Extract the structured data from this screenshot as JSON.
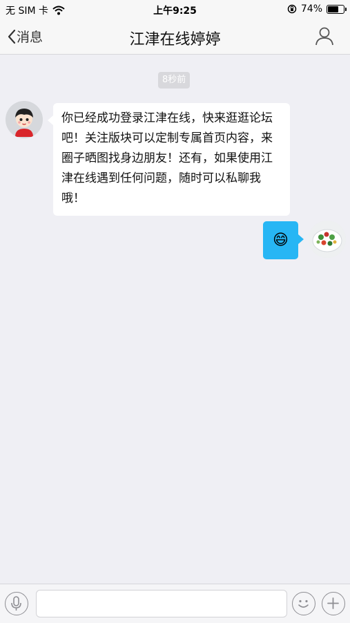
{
  "status_bar": {
    "carrier": "无 SIM 卡",
    "time": "上午9:25",
    "battery_percent": "74%",
    "battery_level": 0.74
  },
  "nav": {
    "back_label": "消息",
    "title": "江津在线婷婷"
  },
  "chat": {
    "timestamp": "8秒前",
    "messages": [
      {
        "side": "left",
        "text": "你已经成功登录江津在线，快来逛逛论坛吧！关注版块可以定制专属首页内容，来圈子晒图找身边朋友！还有，如果使用江津在线遇到任何问题，随时可以私聊我哦！"
      },
      {
        "side": "right",
        "emoji": "😄"
      }
    ]
  },
  "input_bar": {
    "value": "",
    "placeholder": ""
  },
  "colors": {
    "background": "#efeff4",
    "outgoing_bubble": "#27b6f4",
    "incoming_bubble": "#ffffff"
  },
  "icons": {
    "back": "chevron-left-icon",
    "profile": "person-icon",
    "voice": "microphone-icon",
    "emoji": "smiley-icon",
    "plus": "plus-icon",
    "wifi": "wifi-icon",
    "lock": "rotation-lock-icon"
  }
}
